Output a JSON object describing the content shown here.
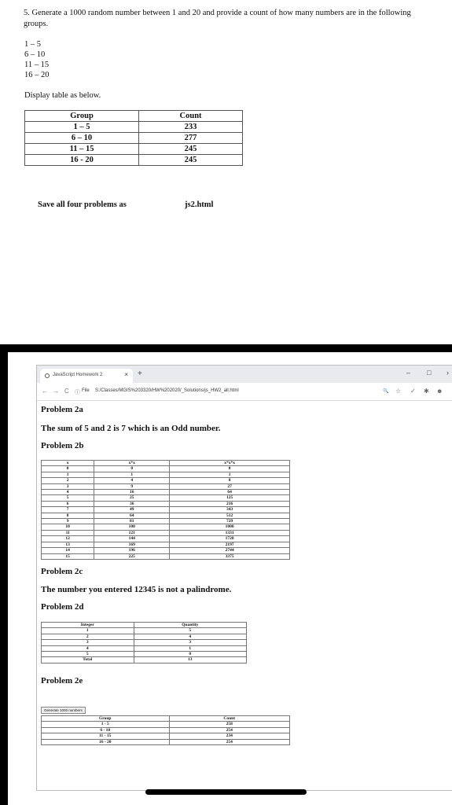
{
  "question": {
    "text": "5.  Generate a 1000 random number between 1 and 20 and provide a count of how many numbers are in the following groups.",
    "ranges": [
      "1 – 5",
      "6 – 10",
      "11 – 15",
      "16 – 20"
    ],
    "display_text": "Display table as below.",
    "table": {
      "headers": [
        "Group",
        "Count"
      ],
      "rows": [
        [
          "1 – 5",
          "233"
        ],
        [
          "6 – 10",
          "277"
        ],
        [
          "11 – 15",
          "245"
        ],
        [
          "16 - 20",
          "245"
        ]
      ]
    },
    "save_text": "Save all four problems as",
    "filename": "js2.html"
  },
  "browser": {
    "tab_title": "JavaScript Homework 2",
    "tab_close": "×",
    "new_tab": "+",
    "min": "–",
    "max": "□",
    "close": "›",
    "back": "←",
    "forward": "→",
    "reload": "C",
    "info": "ⓘ",
    "file_label": "File",
    "url": "S:/Classes/MGIS%203320/HW%202020/_Solutions/js_HW2_all.html",
    "zoom": "🔍",
    "star": "☆",
    "ext1": "✓",
    "ext2": "✱",
    "profile": "☻"
  },
  "page": {
    "p2a_title": "Problem 2a",
    "p2a_text": "The sum of 5 and 2 is 7 which is an Odd number.",
    "p2b_title": "Problem 2b",
    "p2b_headers": [
      "x",
      "x*x",
      "x*x*x"
    ],
    "p2b_rows": [
      [
        "0",
        "0",
        "0"
      ],
      [
        "1",
        "1",
        "1"
      ],
      [
        "2",
        "4",
        "8"
      ],
      [
        "3",
        "9",
        "27"
      ],
      [
        "4",
        "16",
        "64"
      ],
      [
        "5",
        "25",
        "125"
      ],
      [
        "6",
        "36",
        "216"
      ],
      [
        "7",
        "49",
        "343"
      ],
      [
        "8",
        "64",
        "512"
      ],
      [
        "9",
        "81",
        "729"
      ],
      [
        "10",
        "100",
        "1000"
      ],
      [
        "11",
        "121",
        "1331"
      ],
      [
        "12",
        "144",
        "1728"
      ],
      [
        "13",
        "169",
        "2197"
      ],
      [
        "14",
        "196",
        "2744"
      ],
      [
        "15",
        "225",
        "3375"
      ]
    ],
    "p2c_title": "Problem 2c",
    "p2c_text": "The number you entered 12345 is not a palindrome.",
    "p2d_title": "Problem 2d",
    "p2d_headers": [
      "Integer",
      "Quantity"
    ],
    "p2d_rows": [
      [
        "1",
        "5"
      ],
      [
        "2",
        "4"
      ],
      [
        "3",
        "3"
      ],
      [
        "4",
        "1"
      ],
      [
        "5",
        "0"
      ],
      [
        "Total",
        "13"
      ]
    ],
    "p2e_title": "Problem 2e",
    "p2e_button": "Generate 1000 numbers",
    "p2e_headers": [
      "Group",
      "Count"
    ],
    "p2e_rows": [
      [
        "1 - 5",
        "258"
      ],
      [
        "6 - 10",
        "254"
      ],
      [
        "11 - 15",
        "234"
      ],
      [
        "16 - 20",
        "254"
      ]
    ]
  }
}
